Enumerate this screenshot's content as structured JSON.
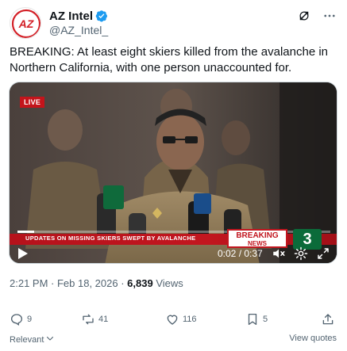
{
  "account": {
    "display_name": "AZ Intel",
    "handle": "@AZ_Intel_",
    "avatar_text": "AZ"
  },
  "tweet": {
    "text": "BREAKING: At least eight skiers killed from the avalanche in Northern California, with one person unaccounted for."
  },
  "video": {
    "live_label": "LIVE",
    "ticker_text": "UPDATES ON MISSING SKIERS SWEPT BY AVALANCHE",
    "breaking_line1": "BREAKING",
    "breaking_line2": "NEWS",
    "channel_number": "3",
    "time_display": "0:02 / 0:37",
    "progress_fraction": 0.054
  },
  "meta": {
    "time": "2:21 PM",
    "separator": " · ",
    "date": "Feb 18, 2026",
    "views_count": "6,839",
    "views_label": " Views"
  },
  "actions": {
    "replies": "9",
    "reposts": "41",
    "likes": "116",
    "bookmarks": "5"
  },
  "footer": {
    "sort_label": "Relevant",
    "view_quotes_label": "View quotes"
  },
  "colors": {
    "brand_red": "#d32027",
    "verified_blue": "#1d9bf0",
    "muted_text": "#536471",
    "news_red": "#c2161f",
    "channel_green": "#0b6b3a"
  },
  "icons": {
    "verified": "verified-badge-icon",
    "grok": "grok-icon",
    "more": "more-icon",
    "play": "play-icon",
    "mute": "mute-icon",
    "settings": "gear-icon",
    "fullscreen": "expand-icon",
    "reply": "reply-icon",
    "repost": "repost-icon",
    "like": "heart-icon",
    "bookmark": "bookmark-icon",
    "share": "share-icon",
    "chevron": "chevron-down-icon"
  }
}
